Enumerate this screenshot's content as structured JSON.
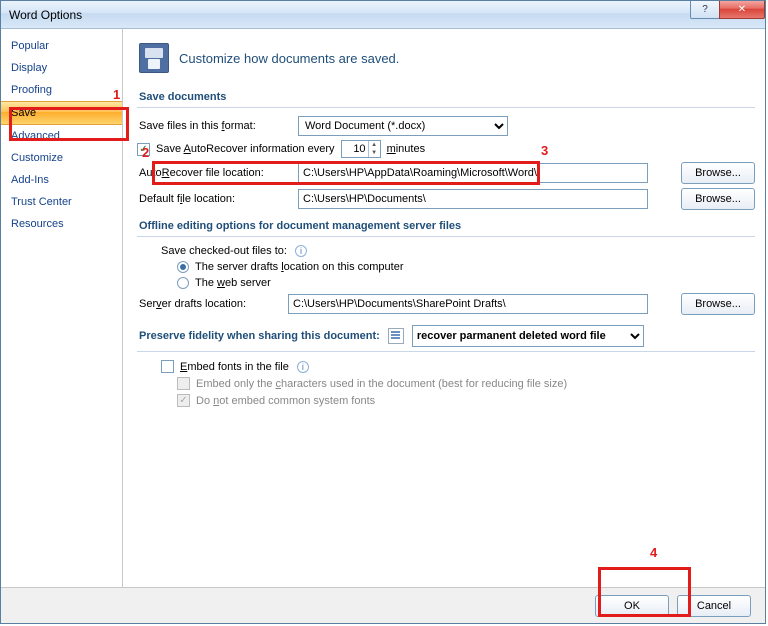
{
  "title": "Word Options",
  "sidebar": {
    "items": [
      {
        "label": "Popular"
      },
      {
        "label": "Display"
      },
      {
        "label": "Proofing"
      },
      {
        "label": "Save"
      },
      {
        "label": "Advanced"
      },
      {
        "label": "Customize"
      },
      {
        "label": "Add-Ins"
      },
      {
        "label": "Trust Center"
      },
      {
        "label": "Resources"
      }
    ],
    "selected": 3
  },
  "header_text": "Customize how documents are saved.",
  "save_documents": {
    "title": "Save documents",
    "format_label": "Save files in this format:",
    "format_value": "Word Document (*.docx)",
    "autorecover_cb_label": "Save AutoRecover information every",
    "autorecover_minutes": "10",
    "autorecover_unit": "minutes",
    "autorecover_loc_label": "AutoRecover file location:",
    "autorecover_loc_value": "C:\\Users\\HP\\AppData\\Roaming\\Microsoft\\Word\\",
    "default_loc_label": "Default file location:",
    "default_loc_value": "C:\\Users\\HP\\Documents\\",
    "browse_label": "Browse..."
  },
  "offline": {
    "title": "Offline editing options for document management server files",
    "save_checked_label": "Save checked-out files to:",
    "radio1": "The server drafts location on this computer",
    "radio2": "The web server",
    "drafts_label": "Server drafts location:",
    "drafts_value": "C:\\Users\\HP\\Documents\\SharePoint Drafts\\",
    "browse_label": "Browse..."
  },
  "preserve": {
    "title": "Preserve fidelity when sharing this document:",
    "dropdown_value": "recover parmanent deleted word file",
    "embed_fonts": "Embed fonts in the file",
    "embed_only_chars": "Embed only the characters used in the document (best for reducing file size)",
    "no_common": "Do not embed common system fonts"
  },
  "footer": {
    "ok": "OK",
    "cancel": "Cancel"
  },
  "annotations": {
    "a1": "1",
    "a2": "2",
    "a3": "3",
    "a4": "4"
  }
}
